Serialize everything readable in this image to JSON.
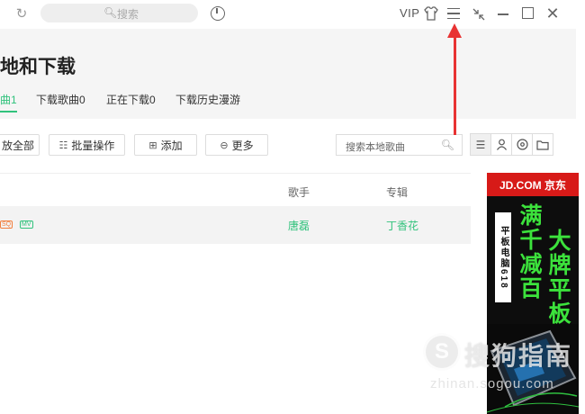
{
  "titlebar": {
    "refresh_icon": "refresh-icon",
    "search_placeholder": "搜索",
    "vip_label": "VIP",
    "icons": [
      "clock-icon",
      "shirt-icon",
      "menu-icon",
      "shrink-icon",
      "minimize-icon",
      "maximize-icon",
      "close-icon"
    ]
  },
  "page": {
    "title": "地和下载",
    "tabs": [
      {
        "label": "曲1",
        "active": true
      },
      {
        "label": "下载歌曲0",
        "active": false
      },
      {
        "label": "正在下载0",
        "active": false
      },
      {
        "label": "下载历史漫游",
        "active": false
      }
    ]
  },
  "toolbar": {
    "play_all_label": "放全部",
    "batch_label": "批量操作",
    "add_label": "添加",
    "more_label": "更多",
    "local_search_placeholder": "搜索本地歌曲"
  },
  "table": {
    "columns": {
      "artist": "歌手",
      "album": "专辑"
    },
    "rows": [
      {
        "tags": [
          "SQ",
          "MV"
        ],
        "artist": "唐磊",
        "album": "丁香花"
      }
    ]
  },
  "ad": {
    "brand": "JD.COM 京东",
    "vertical_text": "平板电脑618",
    "big_text_1": "满千减百",
    "big_text_2": "大牌平板"
  },
  "watermark": {
    "brand": "搜狗指南",
    "url": "zhinan.sogou.com"
  },
  "colors": {
    "accent_green": "#31c27c",
    "arrow_red": "#e83333",
    "ad_red": "#d71a18",
    "ad_green": "#3ce23c"
  }
}
